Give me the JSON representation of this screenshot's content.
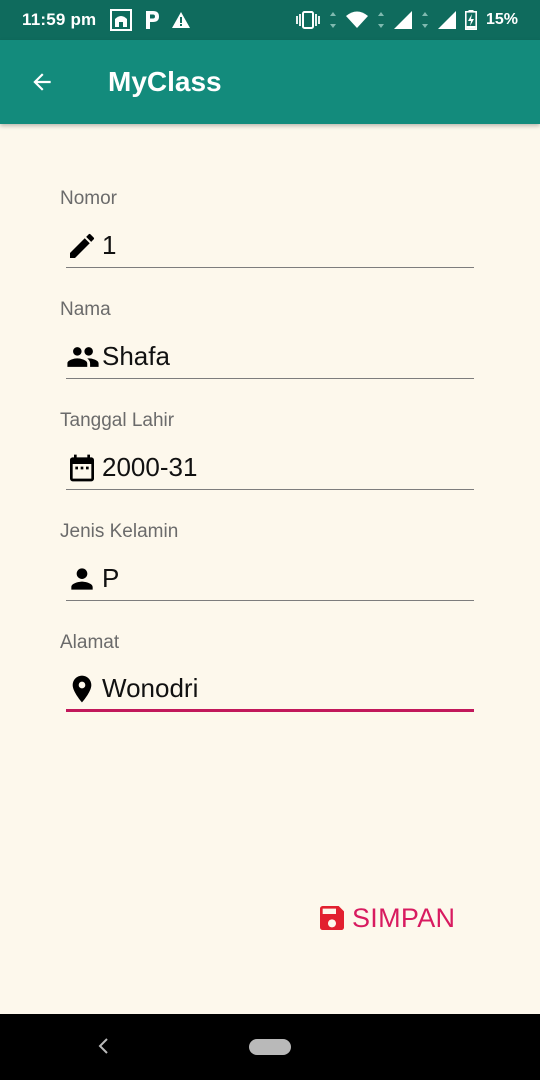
{
  "status_bar": {
    "time": "11:59 pm",
    "battery": "15%",
    "left_icons": [
      "mosque-icon",
      "parking-p-icon",
      "warning-icon"
    ],
    "right_icons": [
      "vibrate-icon",
      "wifi-icon",
      "signal-icon",
      "signal-icon",
      "battery-charging-icon"
    ]
  },
  "app_bar": {
    "title": "MyClass",
    "back_icon": "arrow-back-icon",
    "color": "#138b7c"
  },
  "form": {
    "fields": [
      {
        "label": "Nomor",
        "value": "1",
        "icon": "pencil-icon"
      },
      {
        "label": "Nama",
        "value": "Shafa",
        "icon": "people-icon"
      },
      {
        "label": "Tanggal Lahir",
        "value": "2000-31",
        "icon": "calendar-icon"
      },
      {
        "label": "Jenis Kelamin",
        "value": "P",
        "icon": "person-icon"
      },
      {
        "label": "Alamat",
        "value": "Wonodri",
        "icon": "location-pin-icon",
        "focused": true
      }
    ]
  },
  "save_button": {
    "label": "SIMPAN",
    "icon": "floppy-disk-icon",
    "color": "#d81b60",
    "icon_color": "#e2202f"
  },
  "colors": {
    "status_bar": "#0f6b5d",
    "background": "#fdf8ec",
    "focus_underline": "#c2185b"
  }
}
